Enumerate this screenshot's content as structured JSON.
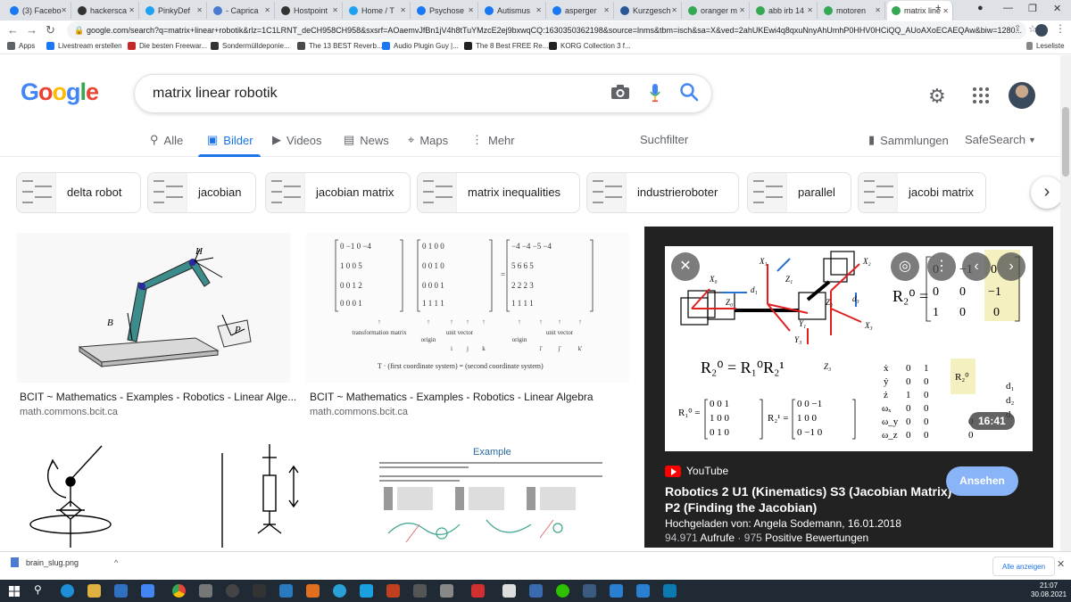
{
  "browser": {
    "tabs": [
      {
        "label": "(3) Facebo",
        "fav": "#1877f2"
      },
      {
        "label": "hackersca",
        "fav": "#333333"
      },
      {
        "label": "PinkyDef",
        "fav": "#1da1f2"
      },
      {
        "label": "- Caprica",
        "fav": "#4a7bd0"
      },
      {
        "label": "Hostpoint",
        "fav": "#333333"
      },
      {
        "label": "Home / T",
        "fav": "#1da1f2"
      },
      {
        "label": "Psychose",
        "fav": "#1877f2"
      },
      {
        "label": "Autismus",
        "fav": "#1877f2"
      },
      {
        "label": "asperger",
        "fav": "#1877f2"
      },
      {
        "label": "Kurzgesch",
        "fav": "#2b5797"
      },
      {
        "label": "oranger m",
        "fav": "#34a853"
      },
      {
        "label": "abb irb 14",
        "fav": "#34a853"
      },
      {
        "label": "motoren",
        "fav": "#34a853"
      },
      {
        "label": "matrix line",
        "fav": "#34a853"
      }
    ],
    "url": "google.com/search?q=matrix+linear+robotik&rlz=1C1LRNT_deCH958CH958&sxsrf=AOaemvJfBn1jV4h8tTuYMzcE2ej9bxwqCQ:1630350362198&source=lnms&tbm=isch&sa=X&ved=2ahUKEwi4q8qxuNnyAhUmhP0HHV0HCiQQ_AUoAXoECAEQAw&biw=1280...",
    "bookmarks": [
      {
        "label": "Apps",
        "color": "#5f6368"
      },
      {
        "label": "Livestream erstellen",
        "color": "#1877f2"
      },
      {
        "label": "Die besten Freewar...",
        "color": "#c62828"
      },
      {
        "label": "Sondermülldeponie...",
        "color": "#333333"
      },
      {
        "label": "The 13 BEST Reverb...",
        "color": "#4a4a4a"
      },
      {
        "label": "Audio Plugin Guy |...",
        "color": "#1877f2"
      },
      {
        "label": "The 8 Best FREE Re...",
        "color": "#222222"
      },
      {
        "label": "KORG Collection 3 f...",
        "color": "#222222"
      }
    ],
    "reading_list": "Leseliste"
  },
  "google": {
    "logo": "Google",
    "query": "matrix linear robotik",
    "nav_tabs": {
      "all": "Alle",
      "images": "Bilder",
      "videos": "Videos",
      "news": "News",
      "maps": "Maps",
      "more": "Mehr"
    },
    "search_tools": "Suchfilter",
    "collections": "Sammlungen",
    "safesearch": "SafeSearch",
    "chips": [
      "delta robot",
      "jacobian",
      "jacobian matrix",
      "matrix inequalities",
      "industrieroboter",
      "parallel",
      "jacobi matrix"
    ],
    "results": [
      {
        "title": "BCIT ~ Mathematics - Examples - Robotics - Linear Alge...",
        "source": "math.commons.bcit.ca"
      },
      {
        "title": "BCIT ~ Mathematics - Examples - Robotics - Linear Algebra",
        "source": "math.commons.bcit.ca"
      }
    ],
    "result1_labels": {
      "h": "H",
      "b": "B",
      "p": "P"
    },
    "result2_text": {
      "origin": "origin",
      "transformation_matrix": "transformation matrix",
      "unit_vector": "unit vector",
      "i": "i",
      "j": "j",
      "k": "k",
      "i_prime": "i'",
      "j_prime": "j'",
      "k_prime": "k'",
      "caption": "T     ·     (first coordinate system)  =  (second coordinate system)"
    },
    "result4_heading": "Example",
    "preview": {
      "source": "YouTube",
      "title": "Robotics 2 U1 (Kinematics) S3 (Jacobian Matrix) P2 (Finding the Jacobian)",
      "uploaded": "Hochgeladen von: Angela Sodemann, 16.01.2018",
      "views": "94.971",
      "views_label": "Aufrufe",
      "likes": "975",
      "likes_label": "Positive Bewertungen",
      "duration": "16:41",
      "action": "Ansehen"
    }
  },
  "downloads": {
    "file": "brain_slug.png",
    "show_all": "Alle anzeigen"
  },
  "taskbar": {
    "time": "21:07",
    "date": "30.08.2021"
  }
}
